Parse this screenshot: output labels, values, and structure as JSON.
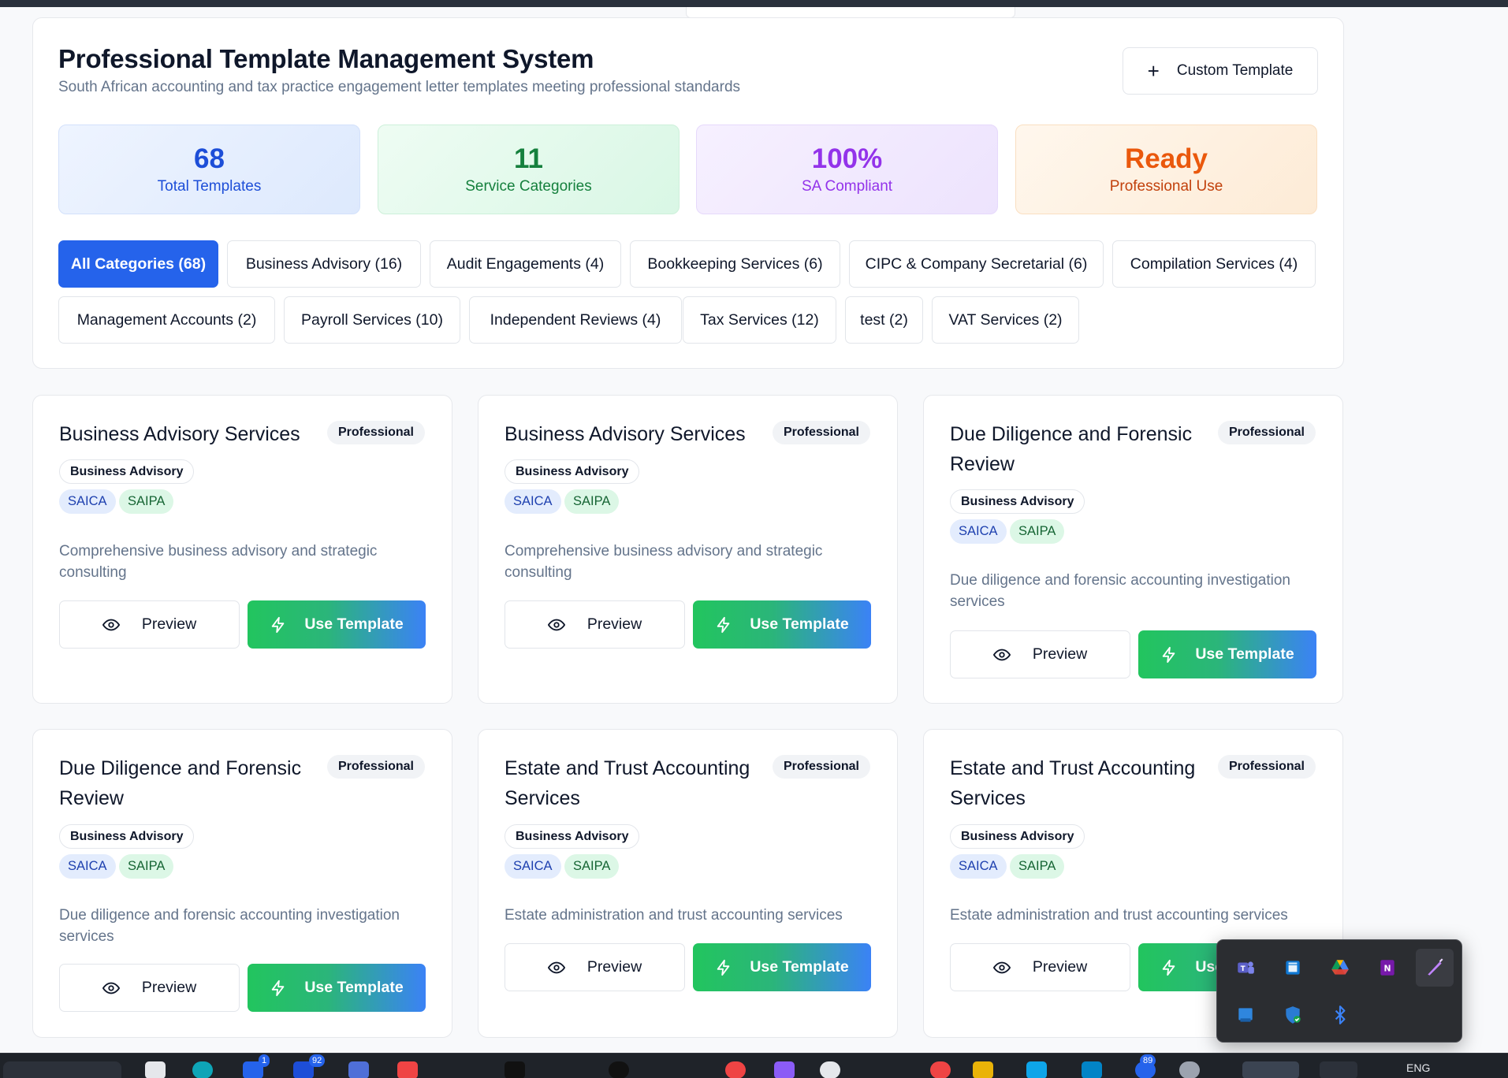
{
  "header": {
    "title": "Professional Template Management System",
    "subtitle": "South African accounting and tax practice engagement letter templates meeting professional standards",
    "custom_button": "Custom Template"
  },
  "stats": [
    {
      "value": "68",
      "label": "Total Templates"
    },
    {
      "value": "11",
      "label": "Service Categories"
    },
    {
      "value": "100%",
      "label": "SA Compliant"
    },
    {
      "value": "Ready",
      "label": "Professional Use"
    }
  ],
  "categories": [
    {
      "label": "All Categories (68)",
      "active": true
    },
    {
      "label": "Business Advisory (16)"
    },
    {
      "label": "Audit Engagements (4)"
    },
    {
      "label": "Bookkeeping Services (6)"
    },
    {
      "label": "CIPC & Company Secretarial (6)"
    },
    {
      "label": "Compilation Services (4)"
    },
    {
      "label": "Management Accounts (2)"
    },
    {
      "label": "Payroll Services (10)"
    },
    {
      "label": "Independent Reviews (4)"
    },
    {
      "label": "Tax Services (12)"
    },
    {
      "label": "test (2)"
    },
    {
      "label": "VAT Services (2)"
    }
  ],
  "cards": [
    {
      "title": "Business Advisory Services",
      "badge": "Professional",
      "category": "Business Advisory",
      "tags": [
        "SAICA",
        "SAIPA"
      ],
      "description": "Comprehensive business advisory and strategic consulting",
      "preview": "Preview",
      "use": "Use Template"
    },
    {
      "title": "Business Advisory Services",
      "badge": "Professional",
      "category": "Business Advisory",
      "tags": [
        "SAICA",
        "SAIPA"
      ],
      "description": "Comprehensive business advisory and strategic consulting",
      "preview": "Preview",
      "use": "Use Template"
    },
    {
      "title": "Due Diligence and Forensic Review",
      "badge": "Professional",
      "category": "Business Advisory",
      "tags": [
        "SAICA",
        "SAIPA"
      ],
      "description": "Due diligence and forensic accounting investigation services",
      "preview": "Preview",
      "use": "Use Template"
    },
    {
      "title": "Due Diligence and Forensic Review",
      "badge": "Professional",
      "category": "Business Advisory",
      "tags": [
        "SAICA",
        "SAIPA"
      ],
      "description": "Due diligence and forensic accounting investigation services",
      "preview": "Preview",
      "use": "Use Template"
    },
    {
      "title": "Estate and Trust Accounting Services",
      "badge": "Professional",
      "category": "Business Advisory",
      "tags": [
        "SAICA",
        "SAIPA"
      ],
      "description": "Estate administration and trust accounting services",
      "preview": "Preview",
      "use": "Use Template"
    },
    {
      "title": "Estate and Trust Accounting Services",
      "badge": "Professional",
      "category": "Business Advisory",
      "tags": [
        "SAICA",
        "SAIPA"
      ],
      "description": "Estate administration and trust accounting services",
      "preview": "Preview",
      "use": "Use Template"
    }
  ],
  "tray": {
    "icons": [
      "teams-icon",
      "outlook-icon",
      "google-drive-icon",
      "onenote-icon",
      "pen-icon",
      "windows-update-icon",
      "security-shield-icon",
      "bluetooth-icon"
    ]
  },
  "taskbar": {
    "badges": [
      "1",
      "92",
      "89"
    ],
    "language": "ENG"
  }
}
